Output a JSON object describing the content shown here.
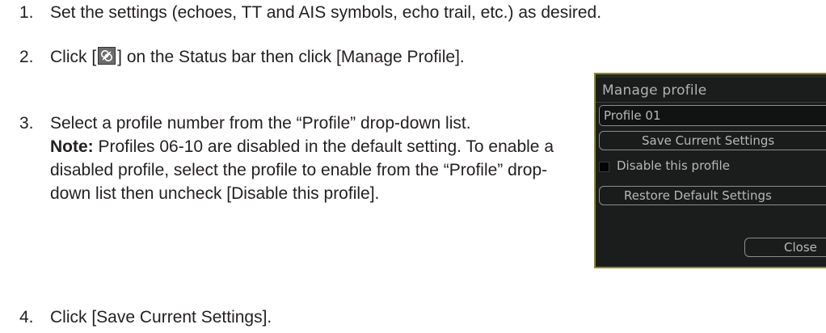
{
  "steps": [
    {
      "number": "1.",
      "text": "Set the settings (echoes, TT and AIS symbols, echo trail, etc.) as desired."
    },
    {
      "number": "2.",
      "text_before_icon": "Click [",
      "icon": "profile-status-icon",
      "text_after_icon": "] on the Status bar then click [Manage Profile]."
    },
    {
      "number": "3.",
      "text": "Select a profile number from the “Profile” drop-down list.",
      "note_label": "Note:",
      "note_text": " Profiles 06-10 are disabled in the default setting. To enable a disabled profile, select the profile to enable from the “Profile” drop-down list then uncheck [Disable this profile]."
    },
    {
      "number": "4.",
      "text": "Click [Save Current Settings]."
    }
  ],
  "dialog": {
    "title": "Manage profile",
    "profile_value": "Profile 01",
    "save_label": "Save Current Settings",
    "disable_label": "Disable this profile",
    "disable_checked": false,
    "restore_label": "Restore Default Settings",
    "close_label": "Close"
  },
  "colors": {
    "text": "#231f20",
    "dialog_bg": "#1a1d1c",
    "dialog_border": "#8c8a26",
    "dialog_text": "#b4b9b7"
  }
}
